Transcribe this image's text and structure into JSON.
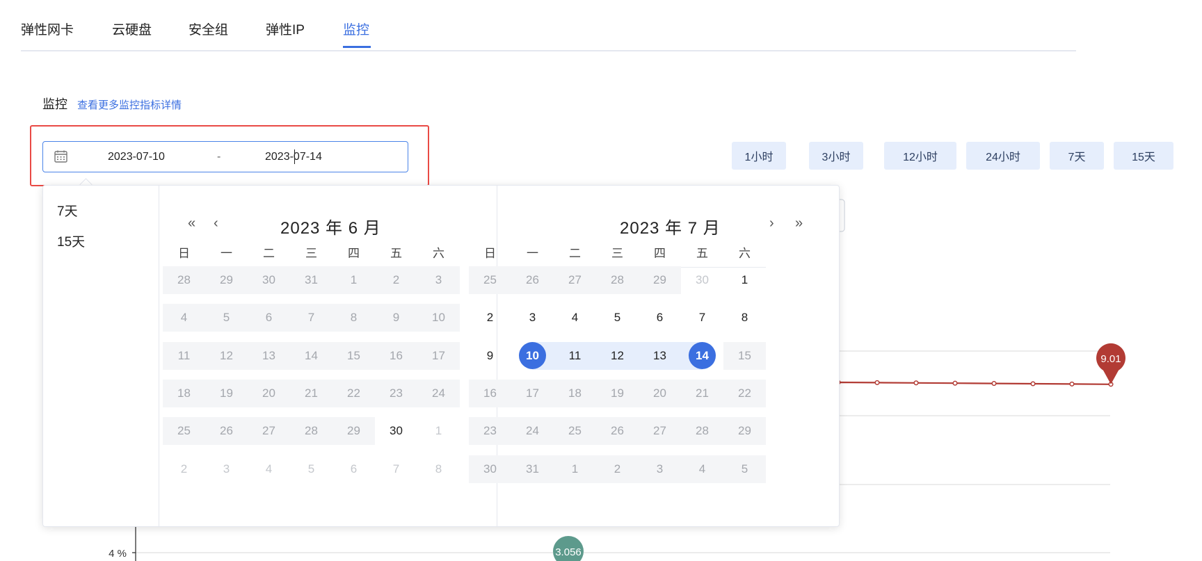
{
  "tabs": [
    {
      "label": "弹性网卡",
      "active": false
    },
    {
      "label": "云硬盘",
      "active": false
    },
    {
      "label": "安全组",
      "active": false
    },
    {
      "label": "弹性IP",
      "active": false
    },
    {
      "label": "监控",
      "active": true
    }
  ],
  "section": {
    "title": "监控",
    "link": "查看更多监控指标详情"
  },
  "range": {
    "start": "2023-07-10",
    "separator": "-",
    "end": "2023-07-14"
  },
  "quick_ranges": [
    "1小时",
    "3小时",
    "12小时",
    "24小时",
    "7天",
    "15天"
  ],
  "picker": {
    "shortcuts": [
      "7天",
      "15天"
    ],
    "weekdays": [
      "日",
      "一",
      "二",
      "三",
      "四",
      "五",
      "六"
    ],
    "left": {
      "title": "2023 年 6 月",
      "prev_year": "«",
      "prev_month": "‹",
      "rows": [
        [
          "28",
          "29",
          "30",
          "31",
          "1",
          "2",
          "3"
        ],
        [
          "4",
          "5",
          "6",
          "7",
          "8",
          "9",
          "10"
        ],
        [
          "11",
          "12",
          "13",
          "14",
          "15",
          "16",
          "17"
        ],
        [
          "18",
          "19",
          "20",
          "21",
          "22",
          "23",
          "24"
        ],
        [
          "25",
          "26",
          "27",
          "28",
          "29",
          "30",
          "1"
        ],
        [
          "2",
          "3",
          "4",
          "5",
          "6",
          "7",
          "8"
        ]
      ]
    },
    "right": {
      "title": "2023 年 7 月",
      "next_month": "›",
      "next_year": "»",
      "rows": [
        [
          "25",
          "26",
          "27",
          "28",
          "29",
          "30",
          "1"
        ],
        [
          "2",
          "3",
          "4",
          "5",
          "6",
          "7",
          "8"
        ],
        [
          "9",
          "10",
          "11",
          "12",
          "13",
          "14",
          "15"
        ],
        [
          "16",
          "17",
          "18",
          "19",
          "20",
          "21",
          "22"
        ],
        [
          "23",
          "24",
          "25",
          "26",
          "27",
          "28",
          "29"
        ],
        [
          "30",
          "31",
          "1",
          "2",
          "3",
          "4",
          "5"
        ]
      ],
      "range_start": "10",
      "range_end": "14"
    }
  },
  "chart_data": {
    "type": "line",
    "y_tick_labels": [
      "4 %"
    ],
    "annotations": [
      {
        "label": "9.01",
        "kind": "max",
        "color": "#b23b34"
      },
      {
        "label": "3.056",
        "kind": "min",
        "color": "#5d9a8c"
      }
    ],
    "series": [
      {
        "values": [
          9.01,
          9.01,
          9.01,
          9.01,
          9.01,
          9.01,
          9.01,
          9.01
        ]
      }
    ],
    "line_color": "#b23b34"
  }
}
